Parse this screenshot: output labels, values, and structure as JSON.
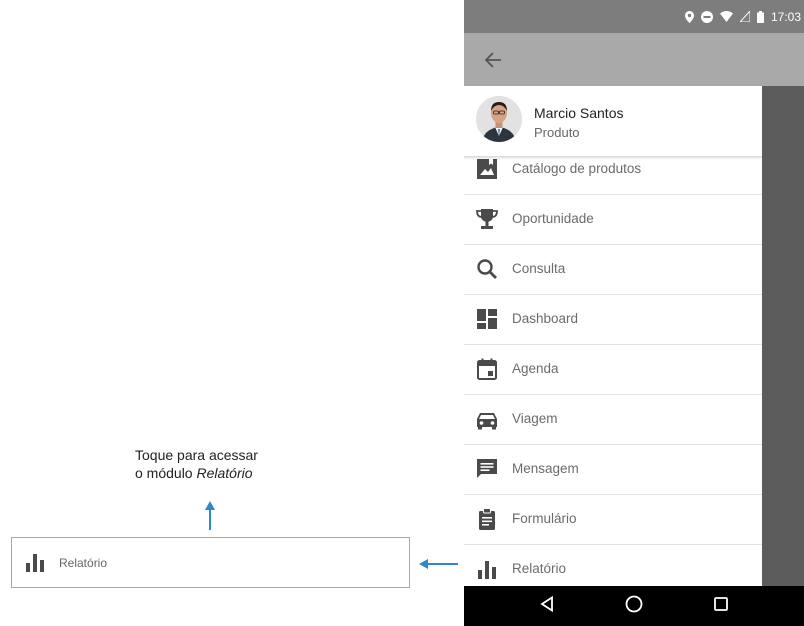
{
  "status_bar": {
    "time": "17:03"
  },
  "profile": {
    "name": "Marcio Santos",
    "role": "Produto"
  },
  "menu": [
    {
      "label": "Catálogo de produtos",
      "icon": "catalog-icon"
    },
    {
      "label": "Oportunidade",
      "icon": "trophy-icon"
    },
    {
      "label": "Consulta",
      "icon": "search-icon"
    },
    {
      "label": "Dashboard",
      "icon": "dashboard-icon"
    },
    {
      "label": "Agenda",
      "icon": "calendar-icon"
    },
    {
      "label": "Viagem",
      "icon": "car-icon"
    },
    {
      "label": "Mensagem",
      "icon": "message-icon"
    },
    {
      "label": "Formulário",
      "icon": "clipboard-icon"
    },
    {
      "label": "Relatório",
      "icon": "bar-chart-icon"
    }
  ],
  "annotation": {
    "line1": "Toque para acessar",
    "line2_prefix": "o módulo ",
    "line2_emphasis": "Relatório"
  },
  "callout": {
    "label": "Relatório"
  },
  "colors": {
    "arrow": "#2f88c8",
    "statusbar": "#7d7d7d",
    "appbar": "#a9a9a9",
    "icon": "#4a4a4a"
  }
}
